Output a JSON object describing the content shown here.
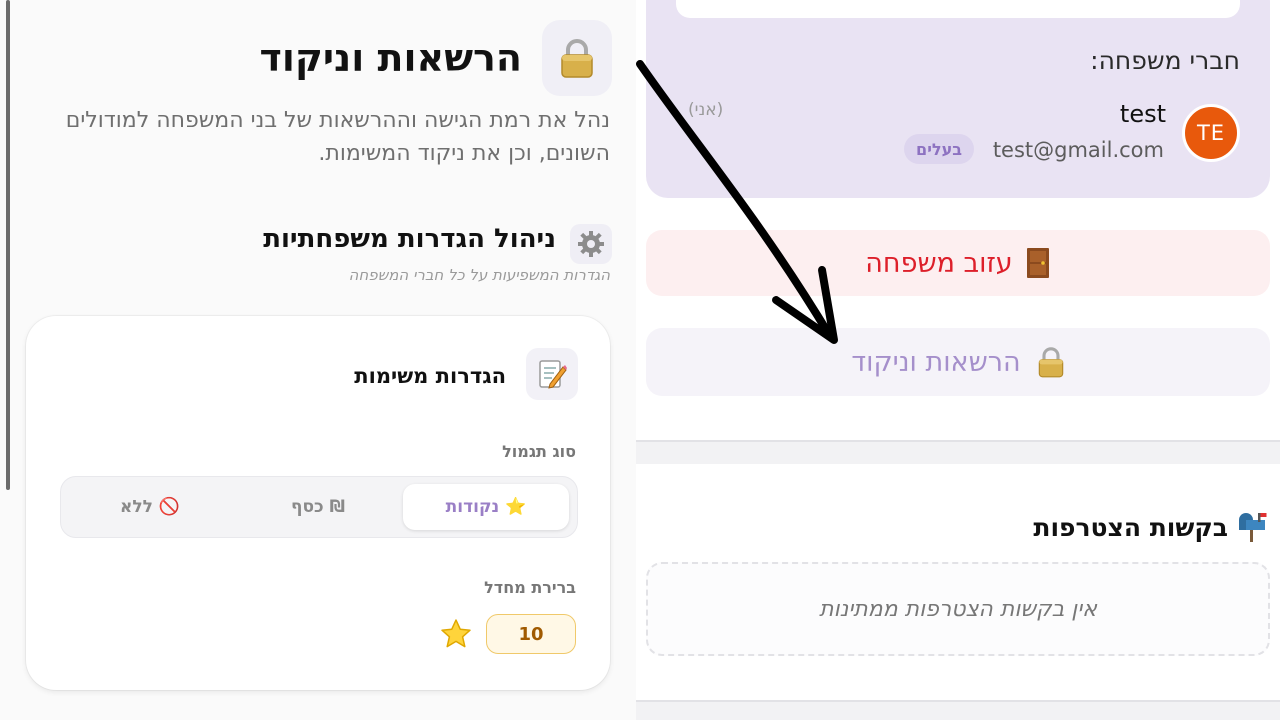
{
  "left": {
    "title": "הרשאות וניקוד",
    "description": "נהל את רמת הגישה וההרשאות של בני המשפחה למודולים השונים, וכן את ניקוד המשימות.",
    "family_settings": {
      "title": "ניהול הגדרות משפחתיות",
      "subtitle": "הגדרות המשפיעות על כל חברי המשפחה"
    },
    "task_settings": {
      "title": "הגדרות משימות",
      "reward_type_label": "סוג תגמול",
      "options": [
        {
          "label": "נקודות",
          "icon": "⭐",
          "selected": true
        },
        {
          "label": "כסף",
          "icon": "₪",
          "selected": false
        },
        {
          "label": "ללא",
          "icon": "🚫",
          "selected": false
        }
      ],
      "default_label": "ברירת מחדל",
      "default_value": "10"
    }
  },
  "right": {
    "members_label": "חברי משפחה:",
    "member": {
      "initials": "TE",
      "name": "test",
      "email": "test@gmail.com",
      "role_badge": "בעלים",
      "you_tag": "(אני)"
    },
    "leave_button": "עזוב משפחה",
    "permissions_button": "הרשאות וניקוד",
    "join_requests_title": "בקשות הצטרפות",
    "no_requests": "אין בקשות הצטרפות ממתינות"
  },
  "colors": {
    "accent_purple": "#9a7fc6",
    "danger_red": "#dd1f2a",
    "avatar_orange": "#e8590c",
    "family_box_bg": "#e9e3f3"
  },
  "icons": {
    "lock": "lock-icon",
    "gear": "gear-icon",
    "memo": "memo-icon",
    "star": "star-icon",
    "door": "door-icon",
    "mailbox": "mailbox-icon"
  }
}
